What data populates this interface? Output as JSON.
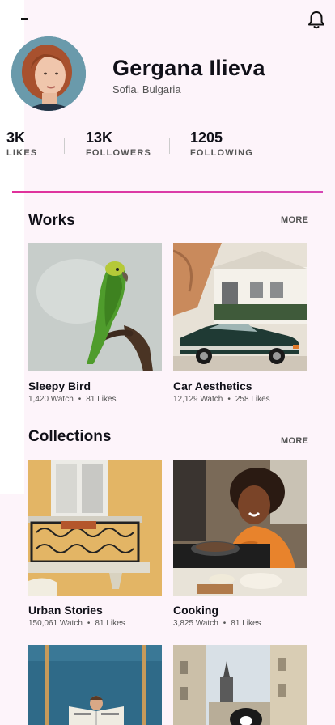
{
  "profile": {
    "name": "Gergana Ilieva",
    "location": "Sofia, Bulgaria"
  },
  "stats": [
    {
      "value": "3K",
      "label": "LIKES"
    },
    {
      "value": "13K",
      "label": "FOLLOWERS"
    },
    {
      "value": "1205",
      "label": "FOLLOWING"
    }
  ],
  "works": {
    "title": "Works",
    "more": "MORE",
    "items": [
      {
        "title": "Sleepy Bird",
        "watch": "1,420 Watch",
        "likes": "81 Likes"
      },
      {
        "title": "Car Aesthetics",
        "watch": "12,129 Watch",
        "likes": "258 Likes"
      }
    ]
  },
  "collections": {
    "title": "Collections",
    "more": "MORE",
    "items": [
      {
        "title": "Urban Stories",
        "watch": "150,061 Watch",
        "likes": "81 Likes"
      },
      {
        "title": "Cooking",
        "watch": "3,825 Watch",
        "likes": "81 Likes"
      }
    ]
  },
  "icons": {
    "notifications": "bell-icon",
    "menu": "menu-icon"
  },
  "colors": {
    "accent": "#e0309a",
    "background": "#fdf4fa"
  }
}
